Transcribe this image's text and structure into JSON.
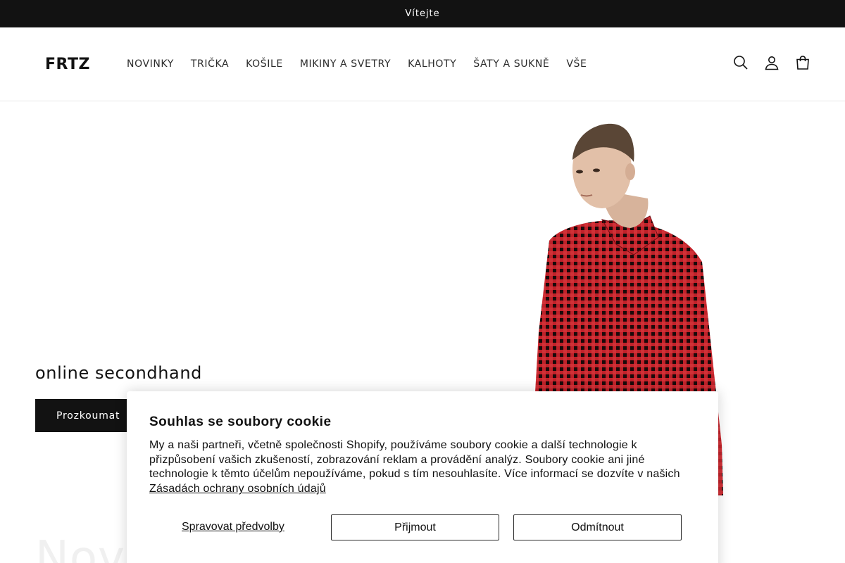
{
  "announcement": {
    "text": "Vítejte"
  },
  "header": {
    "logo": "FRTZ",
    "nav": [
      {
        "label": "NOVINKY"
      },
      {
        "label": "TRIČKA"
      },
      {
        "label": "KOŠILE"
      },
      {
        "label": "MIKINY A SVETRY"
      },
      {
        "label": "KALHOTY"
      },
      {
        "label": "ŠATY A SUKNĚ"
      },
      {
        "label": "VŠE"
      }
    ],
    "icons": [
      "search-icon",
      "account-icon",
      "cart-icon"
    ]
  },
  "hero": {
    "title": "online secondhand",
    "button_label": "Prozkoumat",
    "next_section_heading": "Nov"
  },
  "cookie_banner": {
    "title": "Souhlas se soubory cookie",
    "body": "My a naši partneři, včetně společnosti Shopify, používáme soubory cookie a další technologie k přizpůsobení vašich zkušeností, zobrazování reklam a provádění analýz. Soubory cookie ani jiné technologie k těmto účelům nepoužíváme, pokud s tím nesouhlasíte. Více informací se dozvíte v našich",
    "link_label": "Zásadách ochrany osobních údajů",
    "manage_label": "Spravovat předvolby",
    "accept_label": "Přijmout",
    "decline_label": "Odmítnout"
  },
  "colors": {
    "announcement_bg": "#121212",
    "text": "#121212",
    "shirt_red": "#c0222a",
    "shirt_dark": "#1a0a0a"
  }
}
